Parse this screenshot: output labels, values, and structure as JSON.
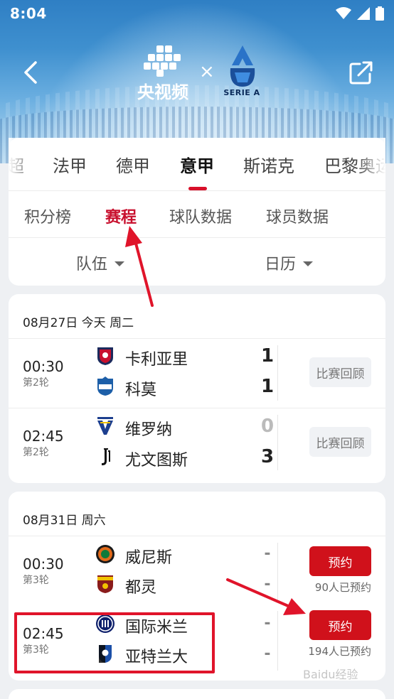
{
  "status_bar": {
    "time": "8:04"
  },
  "header": {
    "brand_left": "央视频",
    "times_sign": "×",
    "brand_right": "SERIE A"
  },
  "league_tabs": [
    "超",
    "法甲",
    "德甲",
    "意甲",
    "斯诺克",
    "巴黎奥运"
  ],
  "league_active": "意甲",
  "sub_tabs": [
    "积分榜",
    "赛程",
    "球队数据",
    "球员数据"
  ],
  "sub_active": "赛程",
  "filters": {
    "team": "队伍",
    "calendar": "日历"
  },
  "day1": {
    "date": "08月27日 今天 周二",
    "matches": [
      {
        "time": "00:30",
        "round": "第2轮",
        "home": "卡利亚里",
        "away": "科莫",
        "home_score": "1",
        "away_score": "1",
        "action": "比赛回顾"
      },
      {
        "time": "02:45",
        "round": "第2轮",
        "home": "维罗纳",
        "away": "尤文图斯",
        "home_score": "0",
        "away_score": "3",
        "action": "比赛回顾"
      }
    ]
  },
  "day2": {
    "date": "08月31日 周六",
    "matches": [
      {
        "time": "00:30",
        "round": "第3轮",
        "home": "威尼斯",
        "away": "都灵",
        "home_score": "-",
        "away_score": "-",
        "action": "预约",
        "reserve_count": "90人已预约"
      },
      {
        "time": "02:45",
        "round": "第3轮",
        "home": "国际米兰",
        "away": "亚特兰大",
        "home_score": "-",
        "away_score": "-",
        "action": "预约",
        "reserve_count": "194人已预约"
      }
    ]
  },
  "watermark": "Baidu经验",
  "colors": {
    "accent": "#c8102e",
    "reserve_button": "#d0111b",
    "annotation": "#e0142a"
  }
}
